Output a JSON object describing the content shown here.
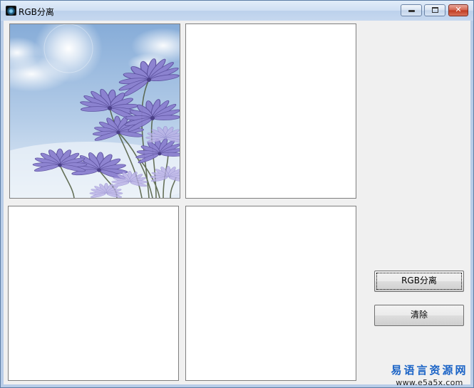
{
  "window": {
    "title": "RGB分离",
    "controls": {
      "minimize": "minimize-icon",
      "maximize": "maximize-icon",
      "close": "close-icon"
    },
    "close_glyph": "✕"
  },
  "picture_boxes": [
    {
      "name": "source-picture",
      "content": "purple daisy flowers against blue sky"
    },
    {
      "name": "output-picture-1"
    },
    {
      "name": "output-picture-2"
    },
    {
      "name": "output-picture-3"
    }
  ],
  "buttons": {
    "rgb_split": "RGB分离",
    "clear": "清除"
  },
  "watermark": {
    "site_name": "易语言资源网",
    "url": "www.e5a5x.com"
  },
  "colors": {
    "title_bar": "#c6d8ef",
    "client_bg": "#f0f0f0",
    "close_button": "#c0391f",
    "watermark": "#1a63c6",
    "flower": "#8a7fcf"
  }
}
